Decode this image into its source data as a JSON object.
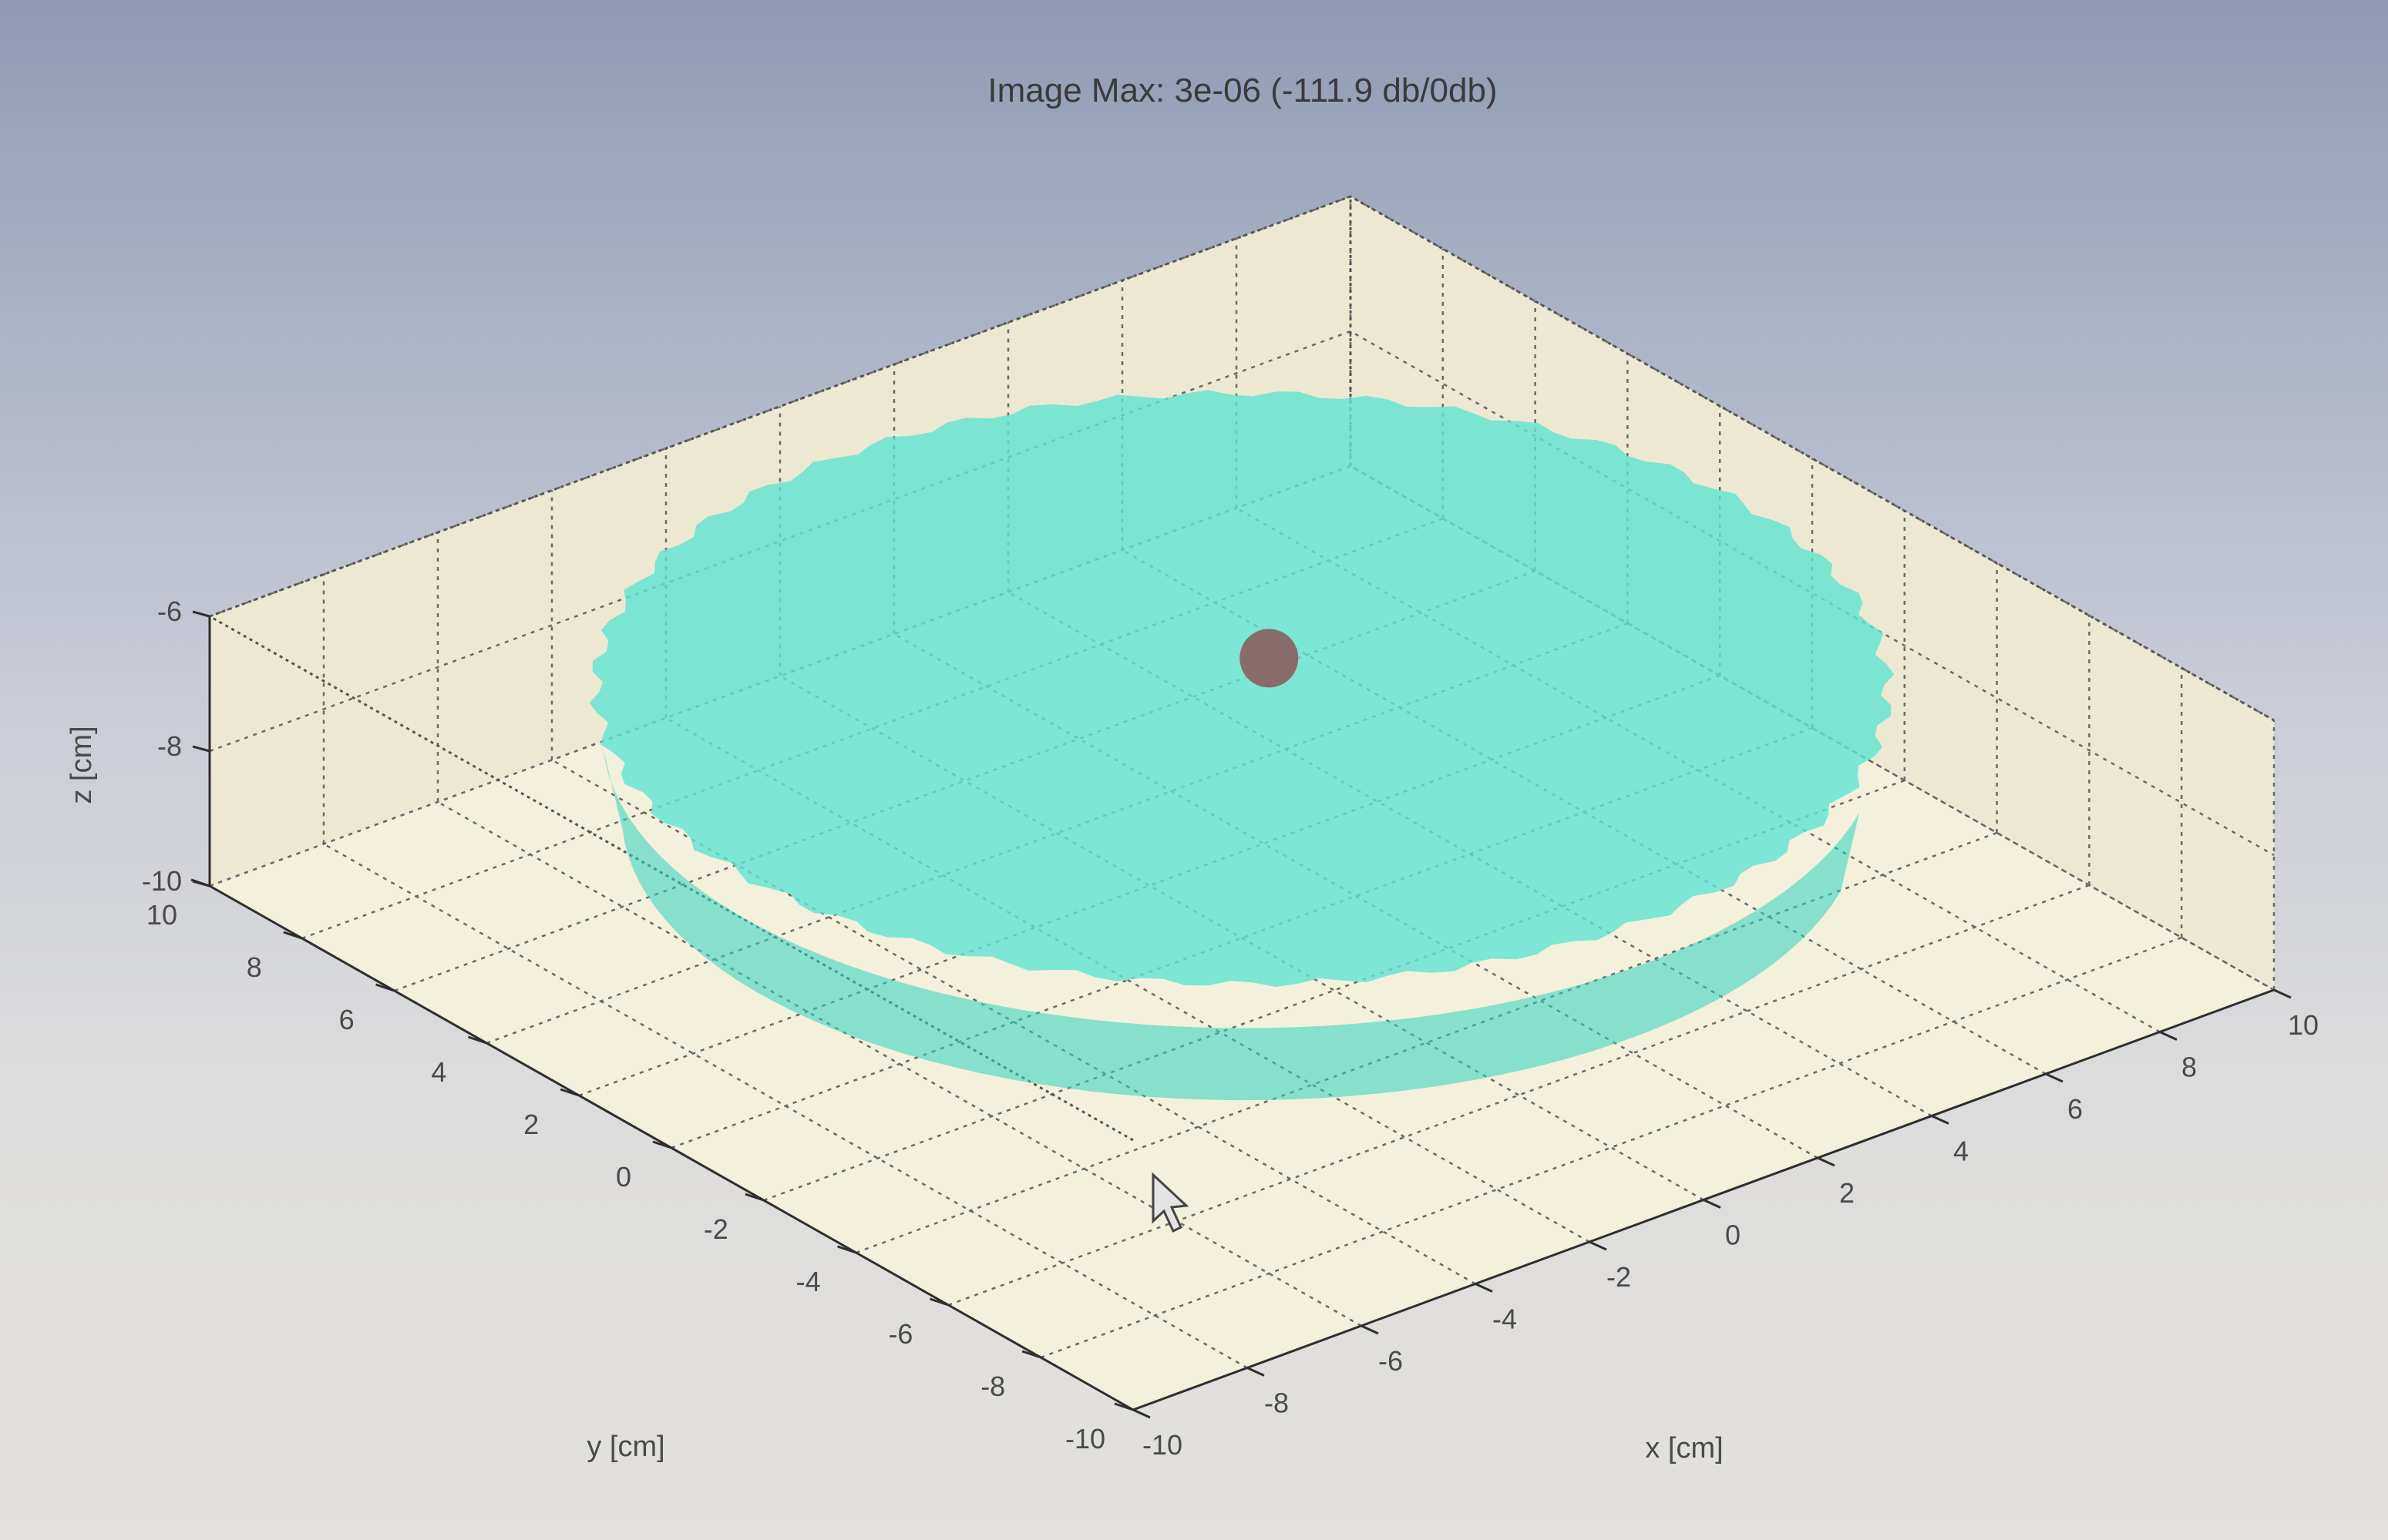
{
  "chart_data": {
    "type": "surface3d",
    "title": "Image Max: 3e-06 (-111.9 db/0db)",
    "xlabel": "x [cm]",
    "ylabel": "y [cm]",
    "zlabel": "z [cm]",
    "xlim": [
      -10,
      10
    ],
    "ylim": [
      -10,
      10
    ],
    "zlim": [
      -10,
      -6
    ],
    "x_ticks": [
      -10,
      -8,
      -6,
      -4,
      -2,
      0,
      2,
      4,
      6,
      8,
      10
    ],
    "y_ticks": [
      -10,
      -8,
      -6,
      -4,
      -2,
      0,
      2,
      4,
      6,
      8,
      10
    ],
    "z_ticks": [
      -10,
      -8,
      -6
    ],
    "grid": true,
    "surface": {
      "shape": "bowl",
      "color": "#5fe3d2",
      "rim_radius_cm": 8.8,
      "rim_z_cm": -6.3,
      "bottom_z_cm": -10
    },
    "point": {
      "x": 2.5,
      "y": 2.5,
      "z": -7.6,
      "color": "#8a6b6b"
    },
    "cursor": "arrow"
  },
  "colors": {
    "box_fill": "#f3f0dc",
    "box_side": "#ece8d2"
  }
}
